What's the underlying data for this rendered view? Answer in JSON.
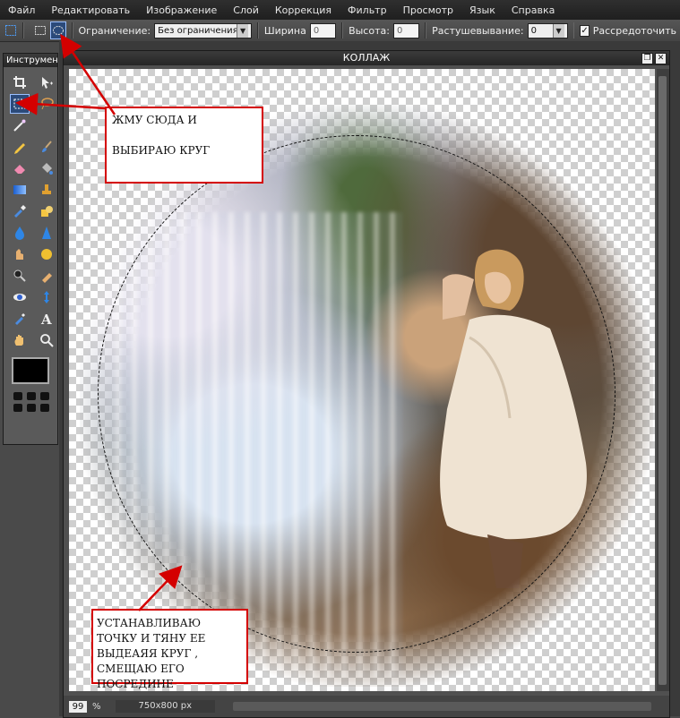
{
  "menu": [
    "Файл",
    "Редактировать",
    "Изображение",
    "Слой",
    "Коррекция",
    "Фильтр",
    "Просмотр",
    "Язык",
    "Справка"
  ],
  "options": {
    "constraint_label": "Ограничение:",
    "constraint_value": "Без ограничения",
    "width_label": "Ширина",
    "width_value": "0",
    "height_label": "Высота:",
    "height_value": "0",
    "feather_label": "Растушевывание:",
    "feather_value": "0",
    "antialias_label": "Рассредоточить",
    "antialias_checked": true
  },
  "tools_panel": {
    "title": "Инструменты"
  },
  "document": {
    "title": "КОЛЛАЖ",
    "zoom": "99",
    "zoom_unit": "%",
    "size": "750x800 px"
  },
  "annotations": {
    "top_line1": "ЖМУ СЮДА И",
    "top_line2": "ВЫБИРАЮ  КРУГ",
    "bottom_text": "УСТАНАВЛИВАЮ ТОЧКУ И ТЯНУ ЕЕ ВЫДЕАЯЯ КРУГ , СМЕЩАЮ ЕГО ПОСРЕДИНЕ"
  },
  "colors": {
    "annotation_border": "#d40000",
    "arrow": "#d40000",
    "foreground_swatch": "#000000"
  }
}
